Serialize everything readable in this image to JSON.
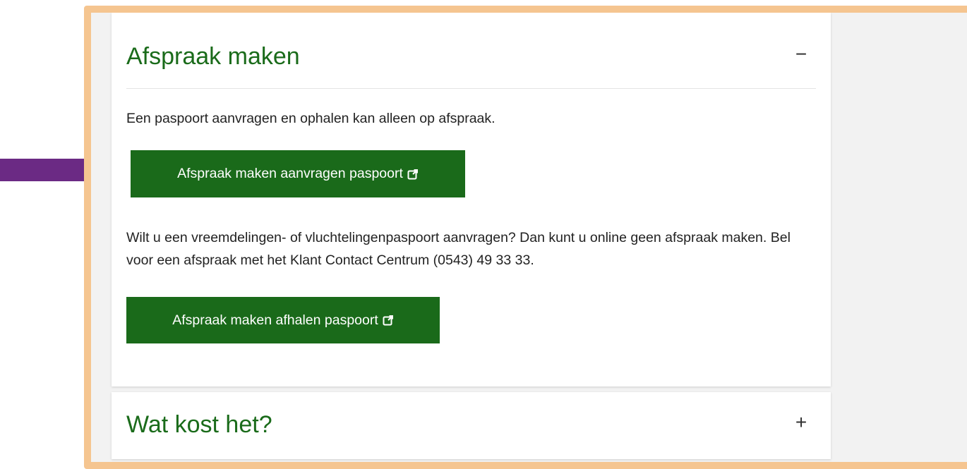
{
  "accordion": {
    "open_item": {
      "title": "Afspraak maken",
      "toggle": "−",
      "intro": "Een paspoort aanvragen en ophalen kan alleen op afspraak.",
      "button_request": "Afspraak maken aanvragen paspoort",
      "info": "Wilt u een vreemdelingen- of vluchtelingenpaspoort aanvragen? Dan kunt u online geen afspraak maken. Bel voor een afspraak met het Klant Contact Centrum (0543) 49 33 33.",
      "button_pickup": "Afspraak maken afhalen paspoort"
    },
    "closed_item": {
      "title": "Wat kost het?",
      "toggle": "+"
    }
  },
  "colors": {
    "highlight_frame": "#f5c590",
    "button_bg": "#1a6a1a",
    "heading": "#1a6b1a",
    "arrow": "#6b2a84"
  },
  "icons": [
    "external-link-icon",
    "arrow-right-icon"
  ]
}
